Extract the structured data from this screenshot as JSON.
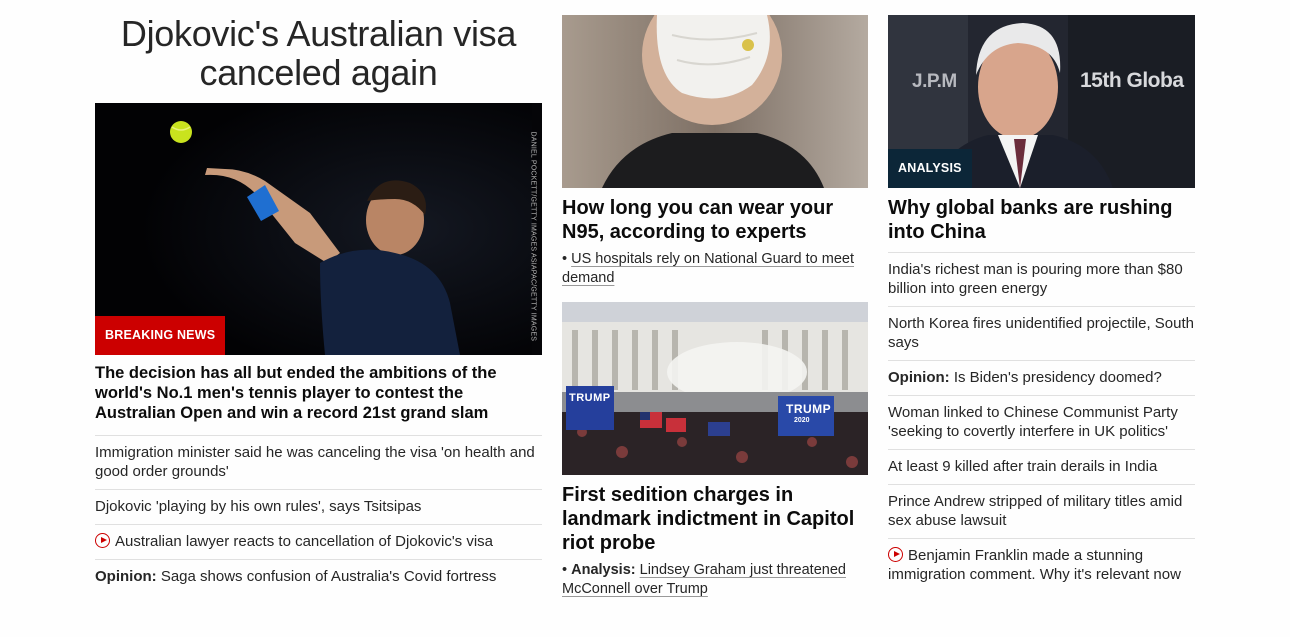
{
  "col1": {
    "headline": "Djokovic's Australian visa canceled again",
    "photo_credit": "DANIEL POCKETT/GETTY IMAGES ASIAPAC/GETTY IMAGES",
    "badge": "BREAKING NEWS",
    "lead": "The decision has all but ended the ambitions of the world's No.1 men's tennis player to contest the Australian Open and win a record 21st grand slam",
    "items": [
      {
        "text": "Immigration minister said he was canceling the visa 'on health and good order grounds'"
      },
      {
        "text": "Djokovic 'playing by his own rules', says Tsitsipas"
      },
      {
        "text": "Australian lawyer reacts to cancellation of Djokovic's visa",
        "video": true
      },
      {
        "prefix": "Opinion:",
        "text": " Saga shows confusion of Australia's Covid fortress"
      }
    ]
  },
  "col2": {
    "story1": {
      "lead": "How long you can wear your N95, according to experts",
      "bullet": "•",
      "sub": "US hospitals rely on National Guard to meet demand"
    },
    "story2": {
      "lead": "First sedition charges in landmark indictment in Capitol riot probe",
      "bullet": "•",
      "tag": "Analysis:",
      "sub": "Lindsey Graham just threatened McConnell over Trump",
      "sign_text_1": "TRUMP",
      "sign_text_2": "TRUMP",
      "sign_year": "2020"
    }
  },
  "col3": {
    "badge": "ANALYSIS",
    "photo_text_1": "J.P.M",
    "photo_text_2": "15th Globa",
    "lead": "Why global banks are rushing into China",
    "items": [
      {
        "text": "India's richest man is pouring more than $80 billion into green energy"
      },
      {
        "text": "North Korea fires unidentified projectile, South says"
      },
      {
        "prefix": "Opinion:",
        "text": " Is Biden's presidency doomed?"
      },
      {
        "text": "Woman linked to Chinese Communist Party 'seeking to covertly interfere in UK politics'"
      },
      {
        "text": "At least 9 killed after train derails in India"
      },
      {
        "text": "Prince Andrew stripped of military titles amid sex abuse lawsuit"
      },
      {
        "text": "Benjamin Franklin made a stunning immigration comment. Why it's relevant now",
        "video": true
      }
    ]
  },
  "colors": {
    "breaking_red": "#cc0000",
    "analysis_navy": "#0c2638",
    "divider": "#e0e0e0"
  }
}
